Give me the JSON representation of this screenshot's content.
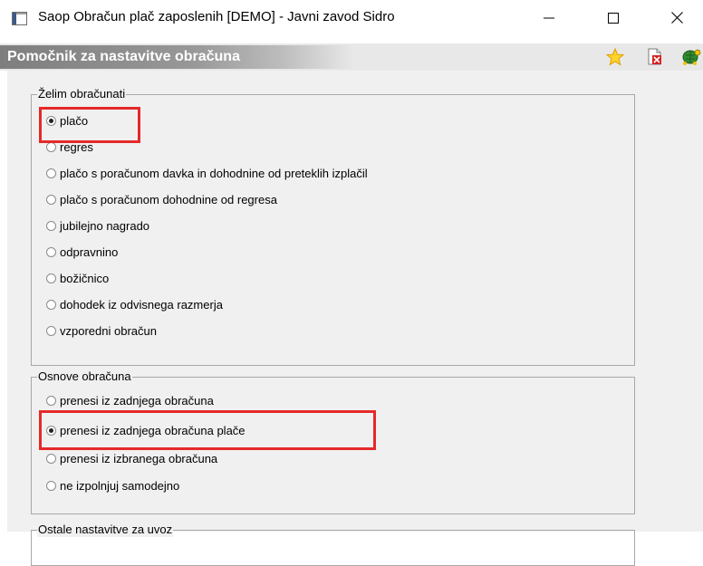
{
  "window": {
    "title": "Saop Obračun plač zaposlenih [DEMO] - Javni zavod Sidro",
    "minimize": "—",
    "maximize": "☐",
    "close": "✕"
  },
  "header": {
    "title": "Pomočnik za nastavitve obračuna",
    "icons": [
      "star-icon",
      "document-delete-icon",
      "turtle-icon"
    ]
  },
  "group1": {
    "legend": "Želim obračunati",
    "options": [
      {
        "label": "plačo",
        "checked": true
      },
      {
        "label": "regres",
        "checked": false
      },
      {
        "label": "plačo s poračunom davka in dohodnine od preteklih izplačil",
        "checked": false
      },
      {
        "label": "plačo s poračunom dohodnine od regresa",
        "checked": false
      },
      {
        "label": "jubilejno nagrado",
        "checked": false
      },
      {
        "label": "odpravnino",
        "checked": false
      },
      {
        "label": "božičnico",
        "checked": false
      },
      {
        "label": "dohodek iz odvisnega razmerja",
        "checked": false
      },
      {
        "label": "vzporedni obračun",
        "checked": false
      }
    ]
  },
  "group2": {
    "legend": "Osnove obračuna",
    "options": [
      {
        "label": "prenesi iz zadnjega obračuna",
        "checked": false
      },
      {
        "label": "prenesi iz zadnjega obračuna plače",
        "checked": true
      },
      {
        "label": "prenesi iz izbranega obračuna",
        "checked": false
      },
      {
        "label": "ne izpolnjuj samodejno",
        "checked": false
      }
    ]
  },
  "group3": {
    "legend": "Ostale nastavitve za uvoz"
  },
  "colors": {
    "highlight": "#e52929",
    "header_gradient_start": "#7e7e7e",
    "content_bg": "#f0f0f0"
  }
}
